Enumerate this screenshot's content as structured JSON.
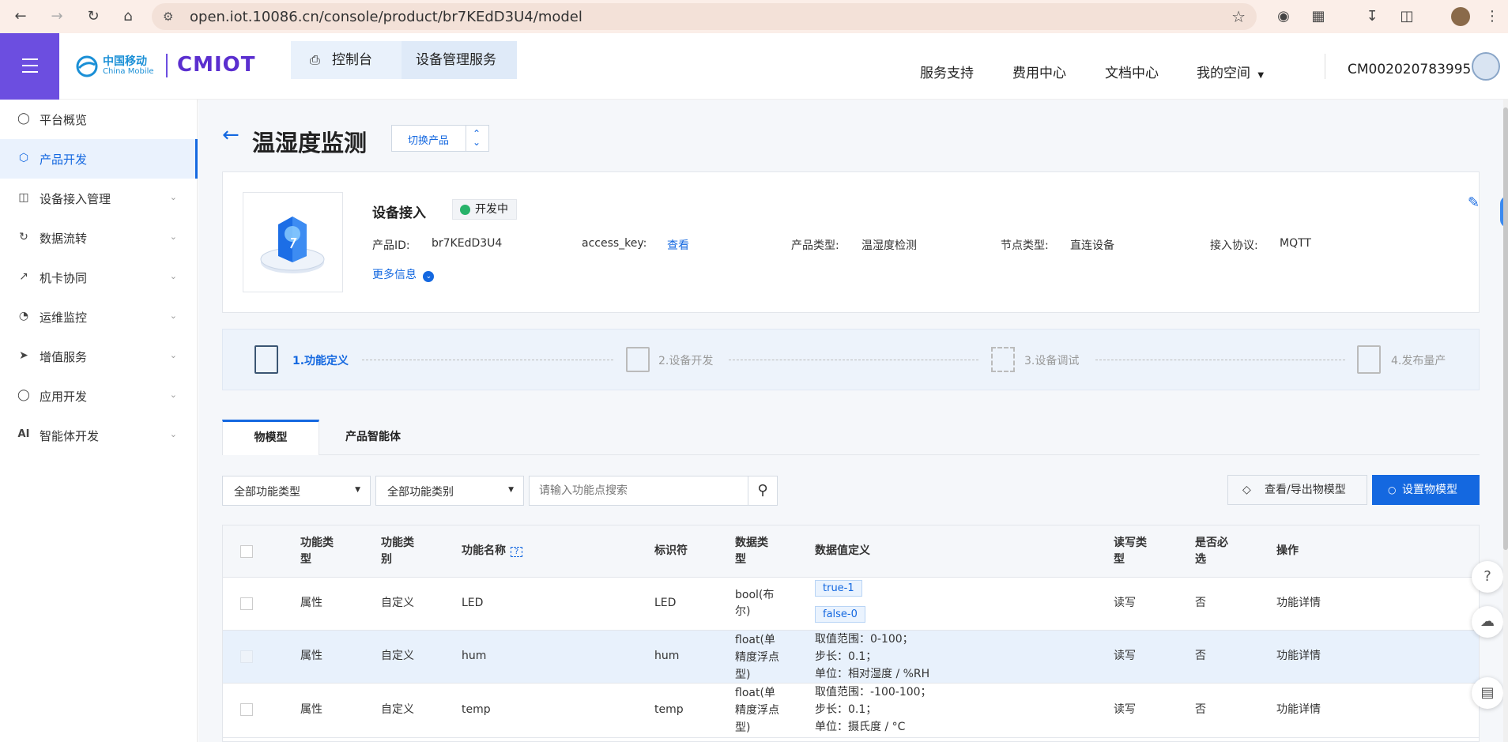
{
  "browser": {
    "url": "open.iot.10086.cn/console/product/br7KEdD3U4/model"
  },
  "header": {
    "logo_cn": "中国移动",
    "logo_en": "China Mobile",
    "logo_brand": "CMIOT",
    "crumbs": [
      "控制台",
      "设备管理服务"
    ],
    "nav": [
      "服务支持",
      "费用中心",
      "文档中心",
      "我的空间"
    ],
    "account": "CM002020783995"
  },
  "sidebar": {
    "items": [
      {
        "label": "平台概览",
        "icon": "overview-icon"
      },
      {
        "label": "产品开发",
        "icon": "cube-icon"
      },
      {
        "label": "设备接入管理",
        "icon": "device-access-icon"
      },
      {
        "label": "数据流转",
        "icon": "data-flow-icon"
      },
      {
        "label": "机卡协同",
        "icon": "card-sync-icon"
      },
      {
        "label": "运维监控",
        "icon": "monitor-icon"
      },
      {
        "label": "增值服务",
        "icon": "value-service-icon"
      },
      {
        "label": "应用开发",
        "icon": "app-dev-icon"
      },
      {
        "label": "智能体开发",
        "icon": "ai-icon"
      }
    ]
  },
  "page": {
    "title": "温湿度监测",
    "switch_label": "切换产品"
  },
  "product": {
    "section_title": "设备接入",
    "status": "开发中",
    "id_label": "产品ID:",
    "id_value": "br7KEdD3U4",
    "access_key_label": "access_key:",
    "access_key_link": "查看",
    "type_label": "产品类型:",
    "type_value": "温湿度检测",
    "node_label": "节点类型:",
    "node_value": "直连设备",
    "protocol_label": "接入协议:",
    "protocol_value": "MQTT",
    "more": "更多信息"
  },
  "steps": [
    "1.功能定义",
    "2.设备开发",
    "3.设备调试",
    "4.发布量产"
  ],
  "tabs": [
    "物模型",
    "产品智能体"
  ],
  "filters": {
    "type": "全部功能类型",
    "category": "全部功能类别",
    "search_placeholder": "请输入功能点搜索"
  },
  "actions": {
    "export": "查看/导出物模型",
    "set": "设置物模型"
  },
  "table": {
    "headers": [
      "功能类型",
      "功能类别",
      "功能名称",
      "标识符",
      "数据类型",
      "数据值定义",
      "读写类型",
      "是否必选",
      "操作"
    ],
    "rows": [
      {
        "type": "属性",
        "category": "自定义",
        "name": "LED",
        "id": "LED",
        "dtype": "bool(布尔)",
        "def": [
          "true-1",
          "false-0"
        ],
        "rw": "读写",
        "required": "否",
        "op": "功能详情"
      },
      {
        "type": "属性",
        "category": "自定义",
        "name": "hum",
        "id": "hum",
        "dtype": "float(单精度浮点型)",
        "def": [
          "取值范围：0-100；",
          "步长：0.1；",
          "单位：相对湿度 / %RH"
        ],
        "rw": "读写",
        "required": "否",
        "op": "功能详情"
      },
      {
        "type": "属性",
        "category": "自定义",
        "name": "temp",
        "id": "temp",
        "dtype": "float(单精度浮点型)",
        "def": [
          "取值范围：-100-100；",
          "步长：0.1；",
          "单位：摄氏度 / °C"
        ],
        "rw": "读写",
        "required": "否",
        "op": "功能详情"
      }
    ]
  }
}
